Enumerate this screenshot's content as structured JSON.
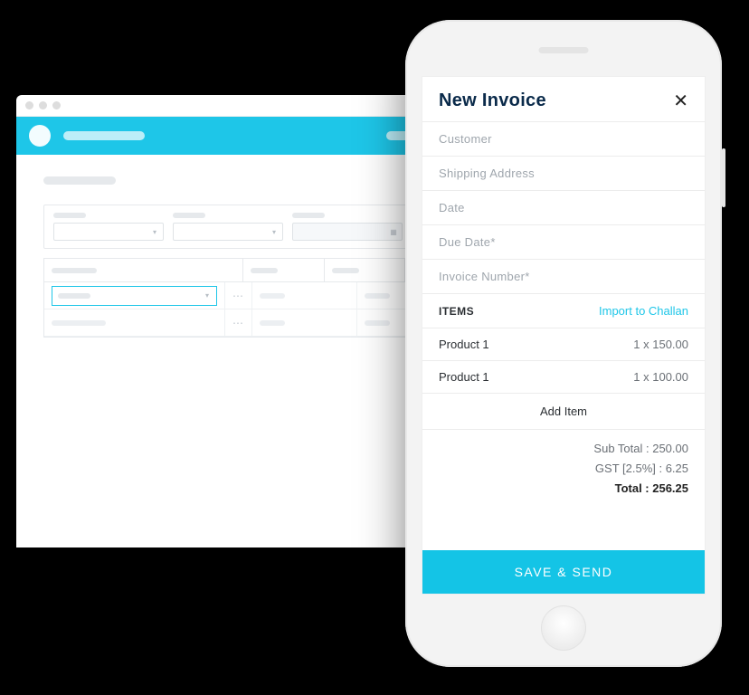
{
  "mobile": {
    "title": "New Invoice",
    "close_glyph": "✕",
    "fields": {
      "customer": "Customer",
      "shipping": "Shipping Address",
      "date": "Date",
      "due_date": "Due Date*",
      "invoice_no": "Invoice Number*"
    },
    "items_section": {
      "label": "ITEMS",
      "import_link": "Import to Challan",
      "rows": [
        {
          "name": "Product 1",
          "qty_text": "1 x 150.00"
        },
        {
          "name": "Product 1",
          "qty_text": "1 x 100.00"
        }
      ],
      "add_item": "Add Item"
    },
    "totals": {
      "subtotal": "Sub Total : 250.00",
      "gst": "GST [2.5%] : 6.25",
      "grand": "Total : 256.25"
    },
    "cta": "SAVE & SEND"
  }
}
